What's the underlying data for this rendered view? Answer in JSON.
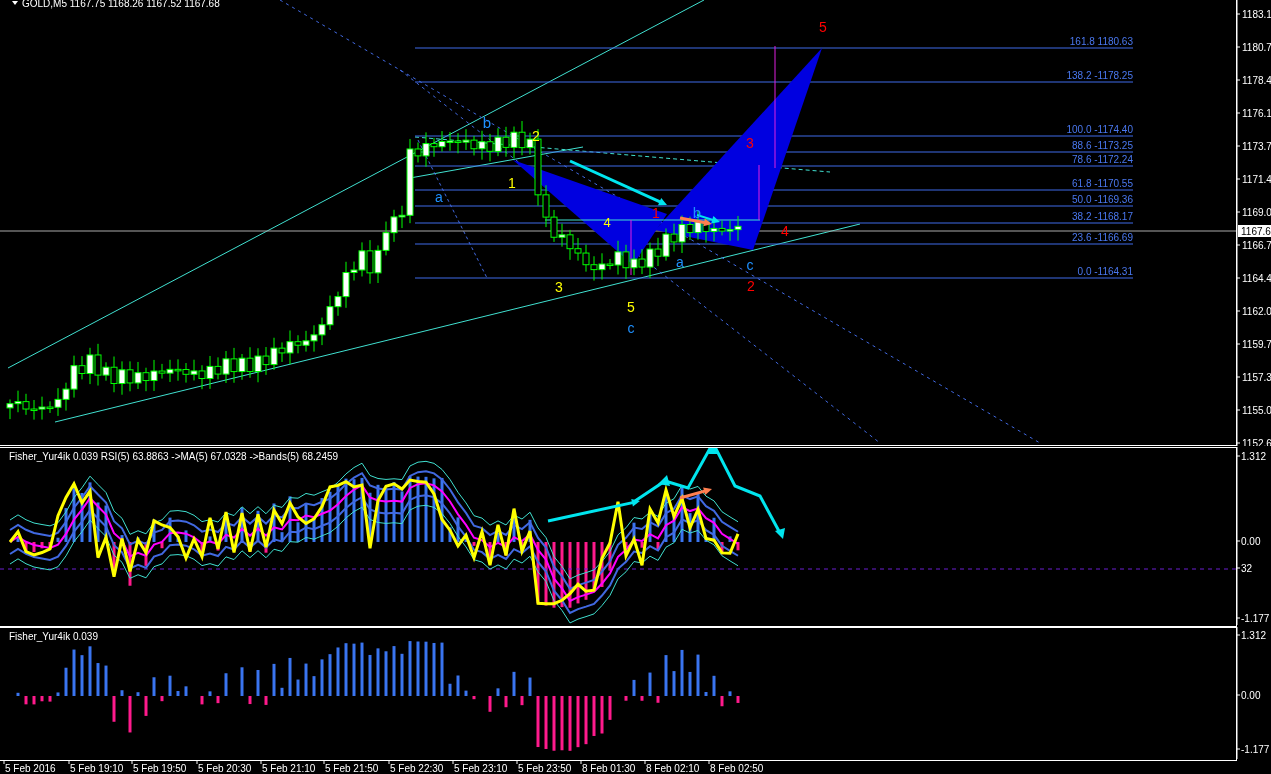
{
  "window": {
    "title": "GOLD,M5",
    "ohlc": "1167.75 1168.26 1167.52 1167.68"
  },
  "main_chart": {
    "price_axis": [
      "1183.1",
      "1180.7",
      "1178.4",
      "1176.1",
      "1173.7",
      "1171.4",
      "1169.0",
      "1166.7",
      "1164.4",
      "1162.0",
      "1159.7",
      "1157.3",
      "1155.0",
      "1152.6"
    ],
    "current_price": "1167.6",
    "fibonacci_levels": [
      {
        "label": "161.8 1180.63"
      },
      {
        "label": "138.2  -1178.25"
      },
      {
        "label": "100.0 -1174.40"
      },
      {
        "label": "88.6 -1173.25"
      },
      {
        "label": "78.6 -1172.24"
      },
      {
        "label": "61.8 -1170.55"
      },
      {
        "label": "50.0 -1169.36"
      },
      {
        "label": "38.2 -1168.17"
      },
      {
        "label": "23.6 -1166.69"
      },
      {
        "label": "0.0 -1164.31"
      }
    ],
    "wave_labels": [
      {
        "text": "5",
        "color": "#ff0000"
      },
      {
        "text": "b",
        "color": "#1e90ff"
      },
      {
        "text": "2",
        "color": "#ffff00"
      },
      {
        "text": "3",
        "color": "#ff0000"
      },
      {
        "text": "1",
        "color": "#ffff00"
      },
      {
        "text": "a",
        "color": "#1e90ff"
      },
      {
        "text": "1",
        "color": "#ff0000"
      },
      {
        "text": "b",
        "color": "#1e90ff"
      },
      {
        "text": "4",
        "color": "#ffff00"
      },
      {
        "text": "4",
        "color": "#ff0000"
      },
      {
        "text": "a",
        "color": "#1e90ff"
      },
      {
        "text": "c",
        "color": "#1e90ff"
      },
      {
        "text": "3",
        "color": "#ffff00"
      },
      {
        "text": "2",
        "color": "#ff0000"
      },
      {
        "text": "5",
        "color": "#ffff00"
      },
      {
        "text": "c",
        "color": "#1e90ff"
      }
    ]
  },
  "indicator_1": {
    "title": "Fisher_Yur4ik 0.039  RSI(5) 63.8863  ->MA(5) 67.0328  ->Bands(5) 68.2459",
    "axis": [
      "1.312",
      "0.00",
      "32",
      "-1.177"
    ]
  },
  "indicator_2": {
    "title": "Fisher_Yur4ik 0.039",
    "axis": [
      "1.312",
      "0.00",
      "-1.177"
    ]
  },
  "time_axis": [
    "5 Feb 2016",
    "5 Feb 19:10",
    "5 Feb 19:50",
    "5 Feb 20:30",
    "5 Feb 21:10",
    "5 Feb 21:50",
    "5 Feb 22:30",
    "5 Feb 23:10",
    "5 Feb 23:50",
    "8 Feb 01:30",
    "8 Feb 02:10",
    "8 Feb 02:50"
  ]
}
